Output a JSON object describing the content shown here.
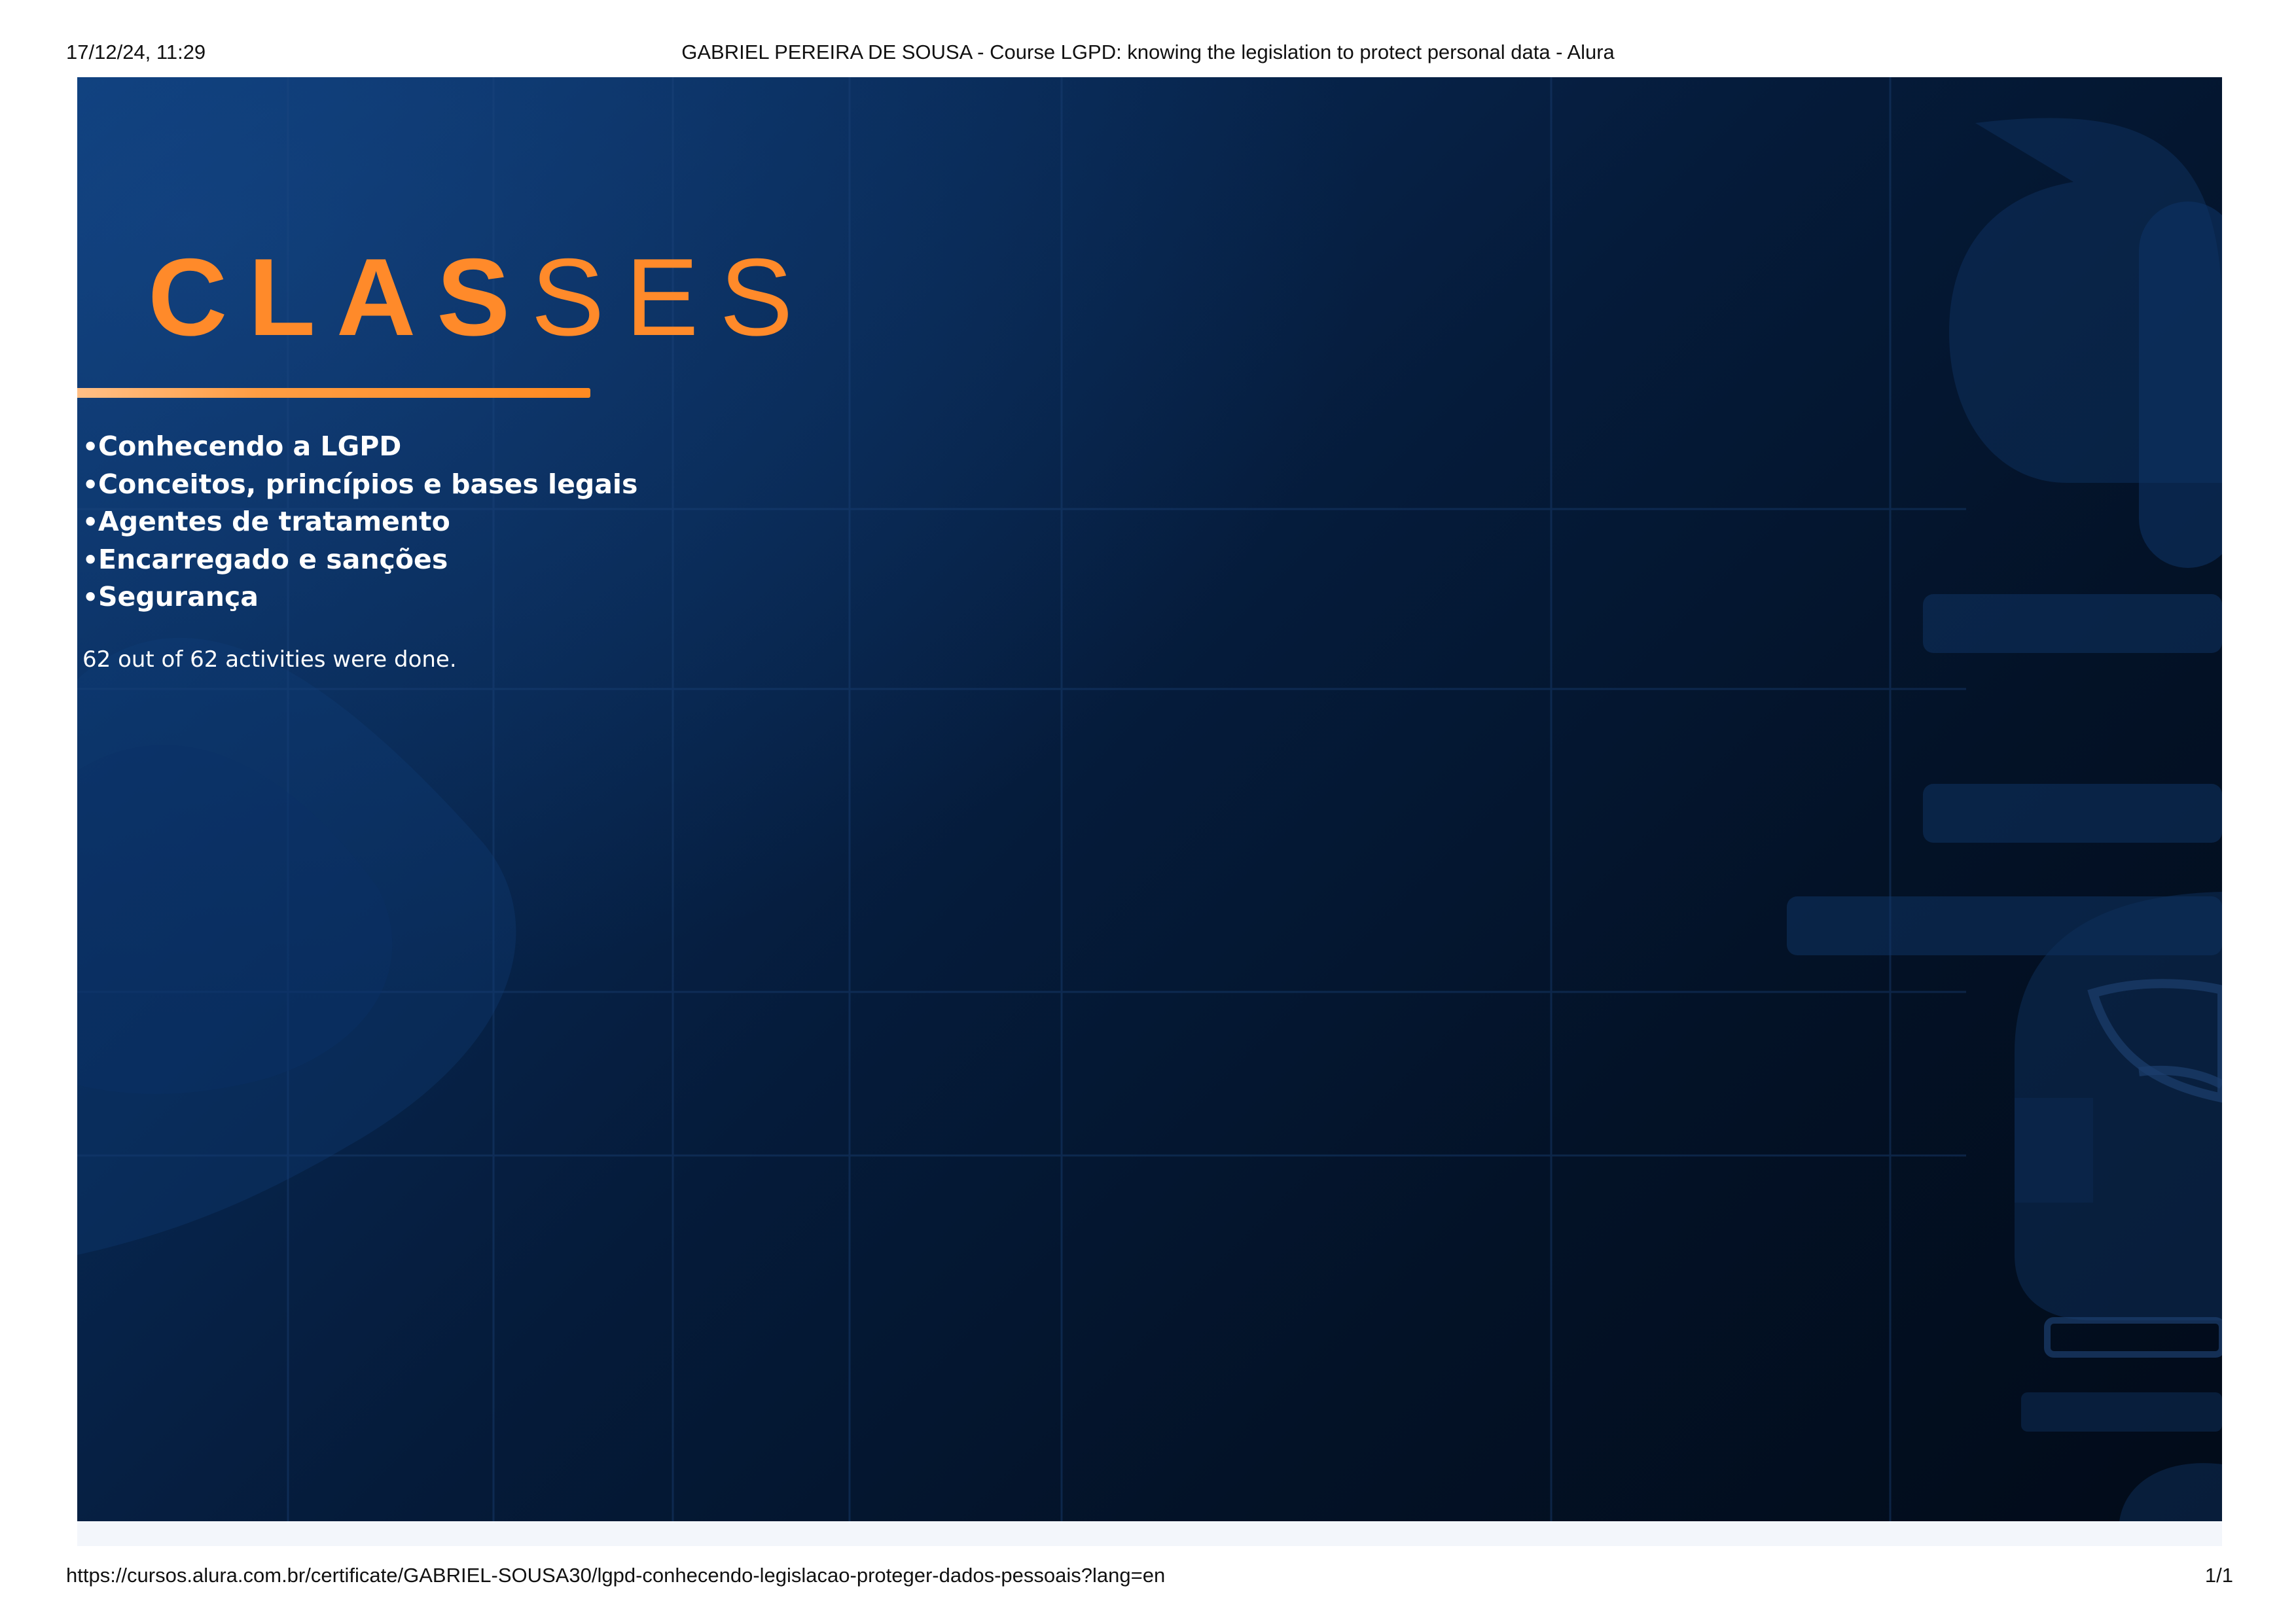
{
  "print_header": {
    "datetime": "17/12/24, 11:29",
    "title": "GABRIEL PEREIRA DE SOUSA - Course LGPD: knowing the legislation to protect personal data - Alura"
  },
  "certificate": {
    "heading_strong": "CLAS",
    "heading_light": "SES",
    "bullet_glyph": "•",
    "lessons": [
      "Conhecendo a LGPD",
      "Conceitos, princípios e bases legais",
      "Agentes de tratamento",
      "Encarregado e sanções",
      "Segurança"
    ],
    "completion_text": "62 out of 62 activities were done.",
    "watermark_text": "alura",
    "colors": {
      "accent": "#ff8a2a",
      "background_dark": "#020b19",
      "background_blue": "#0b3a75",
      "text": "#ffffff"
    }
  },
  "print_footer": {
    "url": "https://cursos.alura.com.br/certificate/GABRIEL-SOUSA30/lgpd-conhecendo-legislacao-proteger-dados-pessoais?lang=en",
    "page": "1/1"
  }
}
